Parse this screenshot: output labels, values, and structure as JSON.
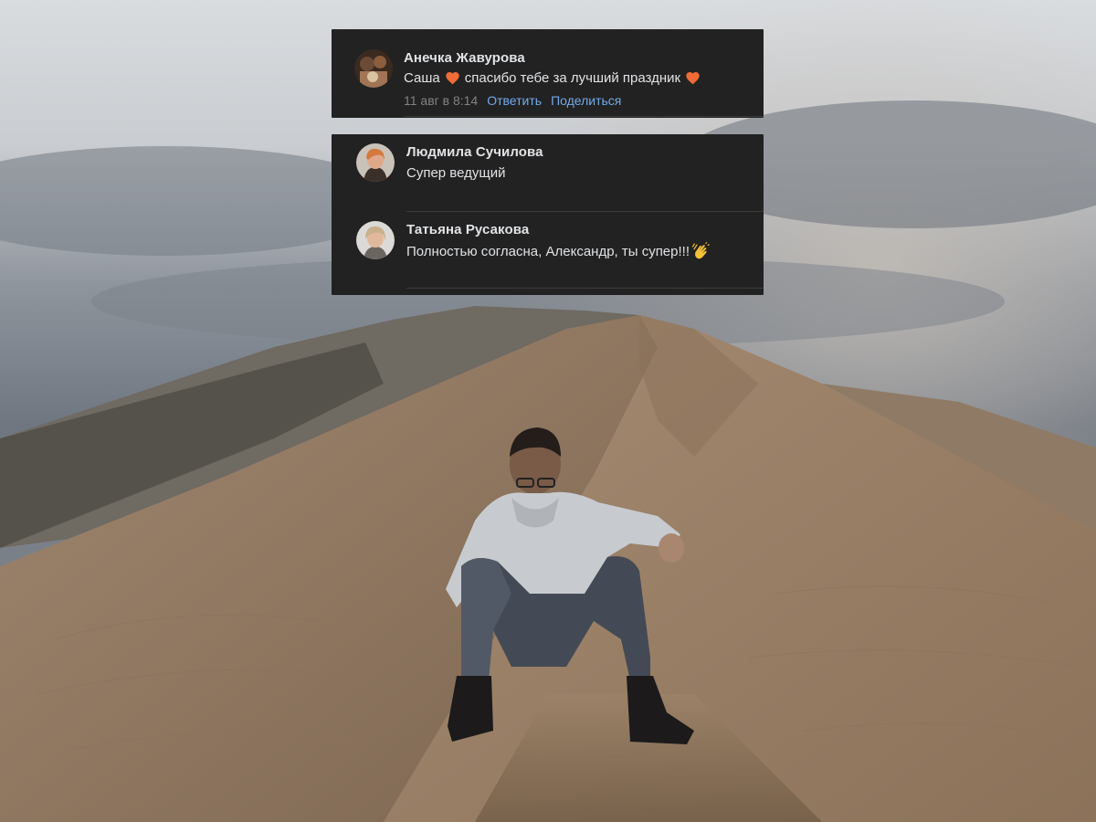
{
  "colors": {
    "card_background": "#222222",
    "primary_text": "#e1e3e6",
    "secondary_text": "#828282",
    "link": "#71aaeb",
    "heart": "#ef6b38"
  },
  "comments_top": [
    {
      "author": "Анечка Жавурова",
      "text_before": "Саша",
      "text_middle": "спасибо тебе за лучший праздник",
      "emoji": [
        "heart-emoji",
        "heart-emoji"
      ],
      "date": "11 авг в 8:14",
      "reply_label": "Ответить",
      "share_label": "Поделиться"
    }
  ],
  "comments_bottom": [
    {
      "author": "Людмила Сучилова",
      "text": "Супер ведущий"
    },
    {
      "author": "Татьяна Русакова",
      "text": "Полностью согласна, Александр, ты супер!!!",
      "emoji": "clapping-hands-emoji"
    }
  ]
}
